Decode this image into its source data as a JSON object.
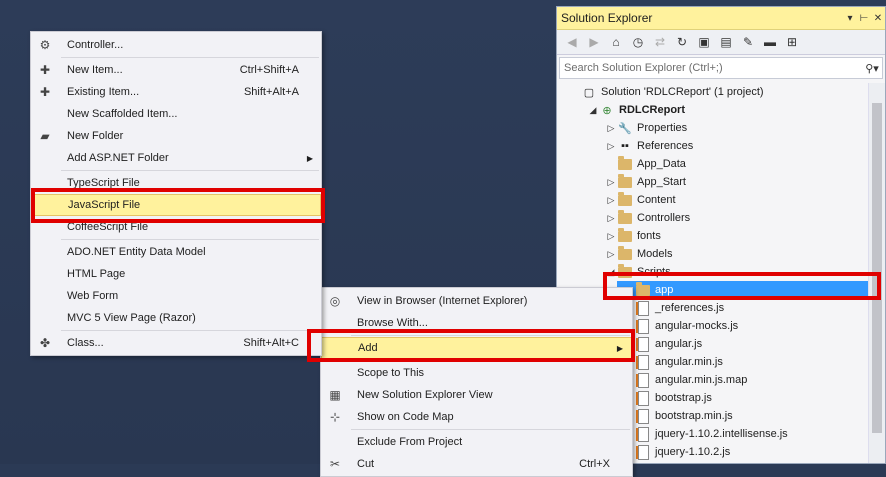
{
  "solution_explorer": {
    "title": "Solution Explorer",
    "search_placeholder": "Search Solution Explorer (Ctrl+;)",
    "tree": [
      {
        "label": "Solution 'RDLCReport' (1 project)",
        "indent": 0,
        "icon": "solution-icon",
        "exp": ""
      },
      {
        "label": "RDLCReport",
        "indent": 1,
        "icon": "web-project-icon",
        "exp": "◢",
        "bold": true
      },
      {
        "label": "Properties",
        "indent": 2,
        "icon": "wrench-icon",
        "exp": "▷"
      },
      {
        "label": "References",
        "indent": 2,
        "icon": "references-icon",
        "exp": "▷"
      },
      {
        "label": "App_Data",
        "indent": 2,
        "icon": "folder-icon",
        "exp": ""
      },
      {
        "label": "App_Start",
        "indent": 2,
        "icon": "folder-icon",
        "exp": "▷"
      },
      {
        "label": "Content",
        "indent": 2,
        "icon": "folder-icon",
        "exp": "▷"
      },
      {
        "label": "Controllers",
        "indent": 2,
        "icon": "folder-icon",
        "exp": "▷"
      },
      {
        "label": "fonts",
        "indent": 2,
        "icon": "folder-icon",
        "exp": "▷"
      },
      {
        "label": "Models",
        "indent": 2,
        "icon": "folder-icon",
        "exp": "▷"
      },
      {
        "label": "Scripts",
        "indent": 2,
        "icon": "folder-icon",
        "exp": "◢"
      },
      {
        "label": "app",
        "indent": 3,
        "icon": "folder-icon",
        "exp": "",
        "selected": true
      },
      {
        "label": "_references.js",
        "indent": 3,
        "icon": "js-file-icon",
        "exp": ""
      },
      {
        "label": "angular-mocks.js",
        "indent": 3,
        "icon": "js-file-icon",
        "exp": ""
      },
      {
        "label": "angular.js",
        "indent": 3,
        "icon": "js-file-icon",
        "exp": ""
      },
      {
        "label": "angular.min.js",
        "indent": 3,
        "icon": "js-file-icon",
        "exp": ""
      },
      {
        "label": "angular.min.js.map",
        "indent": 3,
        "icon": "js-file-icon",
        "exp": ""
      },
      {
        "label": "bootstrap.js",
        "indent": 3,
        "icon": "js-file-icon",
        "exp": ""
      },
      {
        "label": "bootstrap.min.js",
        "indent": 3,
        "icon": "js-file-icon",
        "exp": ""
      },
      {
        "label": "jquery-1.10.2.intellisense.js",
        "indent": 3,
        "icon": "js-file-icon",
        "exp": ""
      },
      {
        "label": "jquery-1.10.2.js",
        "indent": 3,
        "icon": "js-file-icon",
        "exp": ""
      }
    ]
  },
  "add_menu": {
    "items": [
      {
        "label": "Controller...",
        "shortcut": "",
        "icon": "controller-icon"
      },
      {
        "label": "New Item...",
        "shortcut": "Ctrl+Shift+A",
        "icon": "new-item-icon"
      },
      {
        "label": "Existing Item...",
        "shortcut": "Shift+Alt+A",
        "icon": "existing-item-icon"
      },
      {
        "label": "New Scaffolded Item...",
        "shortcut": "",
        "icon": ""
      },
      {
        "label": "New Folder",
        "shortcut": "",
        "icon": "new-folder-icon"
      },
      {
        "label": "Add ASP.NET Folder",
        "shortcut": "",
        "icon": "",
        "submenu": true
      },
      {
        "label": "TypeScript File",
        "shortcut": "",
        "icon": ""
      },
      {
        "label": "JavaScript File",
        "shortcut": "",
        "icon": "",
        "highlighted": true
      },
      {
        "label": "CoffeeScript File",
        "shortcut": "",
        "icon": ""
      },
      {
        "label": "ADO.NET Entity Data Model",
        "shortcut": "",
        "icon": ""
      },
      {
        "label": "HTML Page",
        "shortcut": "",
        "icon": ""
      },
      {
        "label": "Web Form",
        "shortcut": "",
        "icon": ""
      },
      {
        "label": "MVC 5 View Page (Razor)",
        "shortcut": "",
        "icon": ""
      },
      {
        "label": "Class...",
        "shortcut": "Shift+Alt+C",
        "icon": "class-icon"
      }
    ]
  },
  "folder_menu": {
    "items": [
      {
        "label": "View in Browser (Internet Explorer)",
        "shortcut": "",
        "icon": "browser-icon"
      },
      {
        "label": "Browse With...",
        "shortcut": "",
        "icon": ""
      },
      {
        "label": "Add",
        "shortcut": "",
        "icon": "",
        "submenu": true,
        "highlighted": true
      },
      {
        "label": "Scope to This",
        "shortcut": "",
        "icon": ""
      },
      {
        "label": "New Solution Explorer View",
        "shortcut": "",
        "icon": "new-view-icon"
      },
      {
        "label": "Show on Code Map",
        "shortcut": "",
        "icon": "code-map-icon"
      },
      {
        "label": "Exclude From Project",
        "shortcut": "",
        "icon": ""
      },
      {
        "label": "Cut",
        "shortcut": "Ctrl+X",
        "icon": "cut-icon"
      }
    ]
  },
  "colors": {
    "background": "#2b3a55",
    "highlight": "#fff29d",
    "annotation": "#e00000",
    "selection": "#3399ff"
  }
}
